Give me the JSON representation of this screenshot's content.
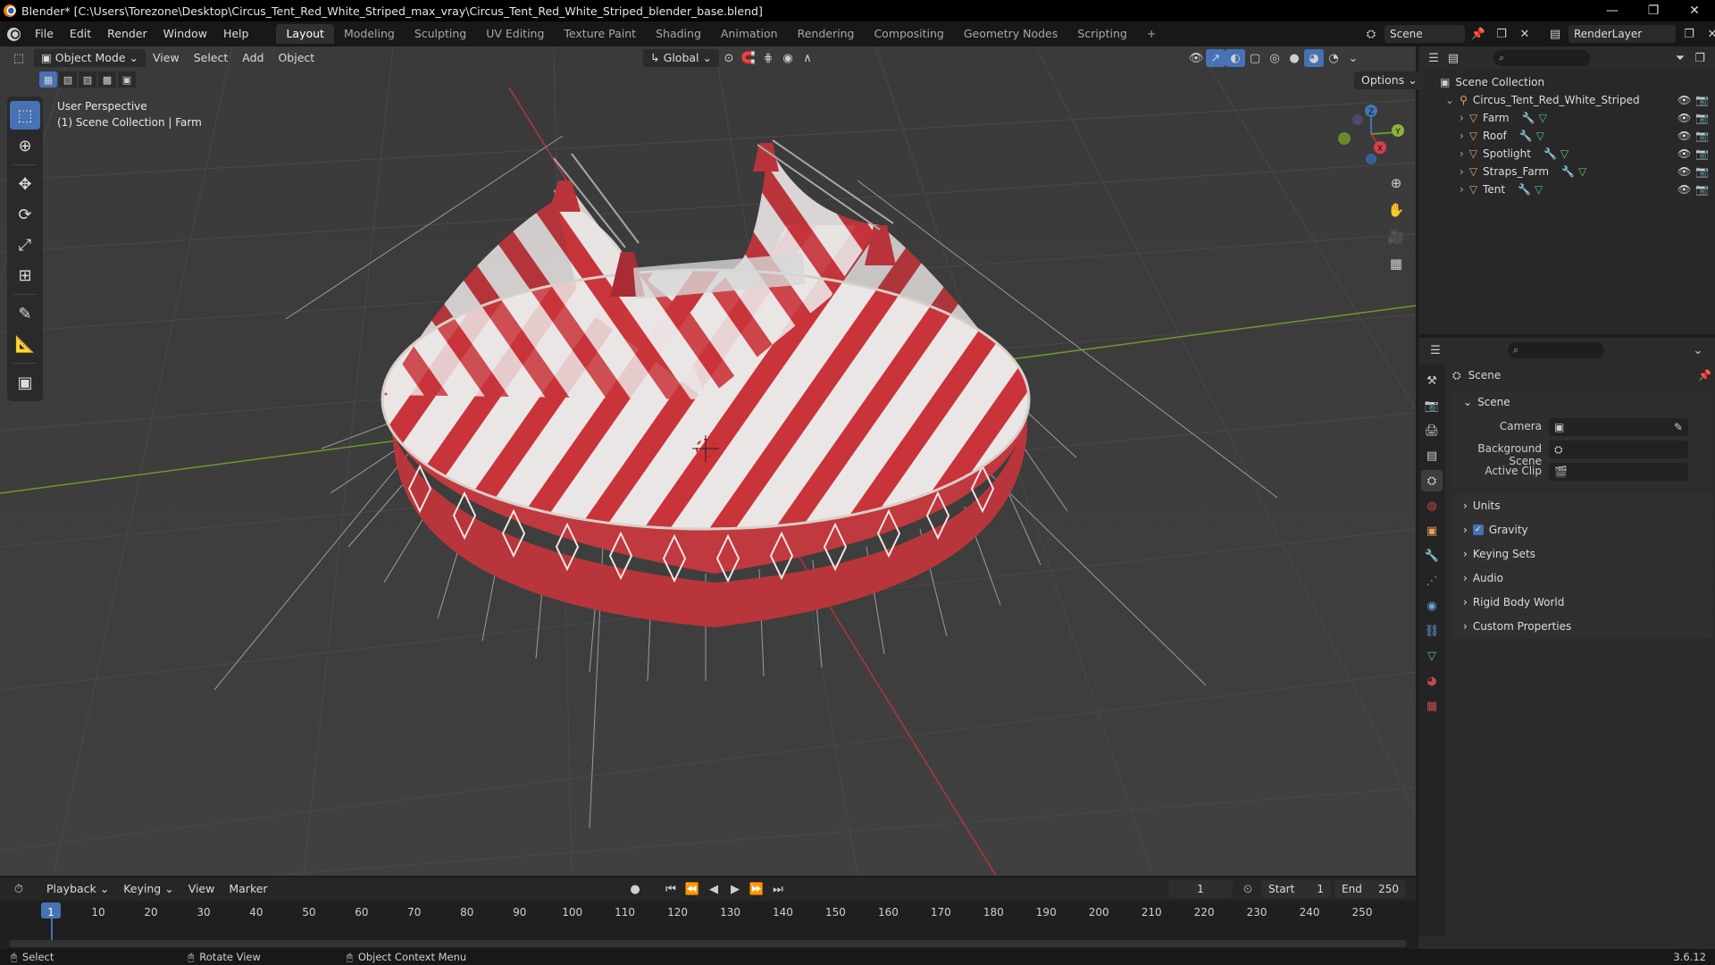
{
  "window": {
    "title": "Blender* [C:\\Users\\Torezone\\Desktop\\Circus_Tent_Red_White_Striped_max_vray\\Circus_Tent_Red_White_Striped_blender_base.blend]",
    "minimize": "—",
    "maximize": "❐",
    "close": "✕"
  },
  "menu": {
    "items": [
      "File",
      "Edit",
      "Render",
      "Window",
      "Help"
    ],
    "workspaces": [
      "Layout",
      "Modeling",
      "Sculpting",
      "UV Editing",
      "Texture Paint",
      "Shading",
      "Animation",
      "Rendering",
      "Compositing",
      "Geometry Nodes",
      "Scripting"
    ],
    "add_workspace": "+",
    "scene": "Scene",
    "view_layer": "RenderLayer"
  },
  "viewport": {
    "mode": "Object Mode",
    "menus": [
      "View",
      "Select",
      "Add",
      "Object"
    ],
    "orientation": "Global",
    "options": "Options",
    "perspective": "User Perspective",
    "collection_info": "(1) Scene Collection | Farm",
    "gizmo": {
      "z": "Z",
      "y": "Y",
      "x": "X"
    }
  },
  "outliner": {
    "root": "Scene Collection",
    "collection": "Circus_Tent_Red_White_Striped",
    "objects": [
      "Farm",
      "Roof",
      "Spotlight",
      "Straps_Farm",
      "Tent"
    ]
  },
  "properties": {
    "context": "Scene",
    "section": "Scene",
    "camera_label": "Camera",
    "background_label": "Background Scene",
    "clip_label": "Active Clip",
    "panels": [
      "Units",
      "Gravity",
      "Keying Sets",
      "Audio",
      "Rigid Body World",
      "Custom Properties"
    ],
    "gravity_enabled": true
  },
  "timeline": {
    "menus": [
      "Playback",
      "Keying",
      "View",
      "Marker"
    ],
    "current_frame": "1",
    "start_label": "Start",
    "start": "1",
    "end_label": "End",
    "end": "250",
    "ticks": [
      "1",
      "10",
      "20",
      "30",
      "40",
      "50",
      "60",
      "70",
      "80",
      "90",
      "100",
      "110",
      "120",
      "130",
      "140",
      "150",
      "160",
      "170",
      "180",
      "190",
      "200",
      "210",
      "220",
      "230",
      "240",
      "250"
    ]
  },
  "status": {
    "select": "Select",
    "rotate": "Rotate View",
    "context_menu": "Object Context Menu",
    "version": "3.6.12"
  },
  "colors": {
    "accent": "#4772b3",
    "tent_red": "#c8343a",
    "tent_white": "#e9e4e4",
    "axis_x": "#b2373c",
    "axis_y": "#6a9a2c"
  }
}
